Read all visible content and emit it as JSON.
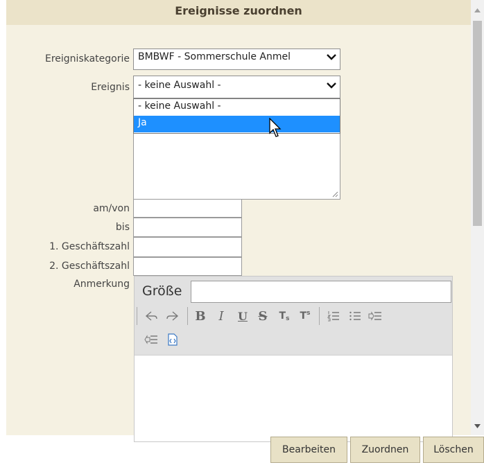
{
  "dialog": {
    "title": "Ereignisse zuordnen"
  },
  "form": {
    "category_label": "Ereigniskategorie",
    "category_value": "BMBWF - Sommerschule Anmel",
    "event_label": "Ereignis",
    "event_value": "- keine Auswahl -",
    "event_options": [
      "- keine Auswahl -",
      "Ja"
    ],
    "event_highlighted": "Ja",
    "date_from_label": "am/von",
    "date_to_label": "bis",
    "ref1_label": "1. Geschäftszahl",
    "ref2_label": "2. Geschäftszahl",
    "note_label": "Anmerkung"
  },
  "editor": {
    "size_label": "Größe",
    "tools": [
      "undo-icon",
      "redo-icon",
      "bold-icon",
      "italic-icon",
      "underline-icon",
      "strikethrough-icon",
      "subscript-icon",
      "superscript-icon",
      "ordered-list-icon",
      "unordered-list-icon",
      "indent-icon",
      "outdent-icon",
      "source-icon"
    ]
  },
  "buttons": {
    "edit": "Bearbeiten",
    "assign": "Zuordnen",
    "delete": "Löschen"
  },
  "colors": {
    "dialog_bg": "#f5f1e2",
    "title_bg": "#ebe3c9",
    "highlight": "#1e90ff",
    "button_bg": "#e8e1c6"
  }
}
